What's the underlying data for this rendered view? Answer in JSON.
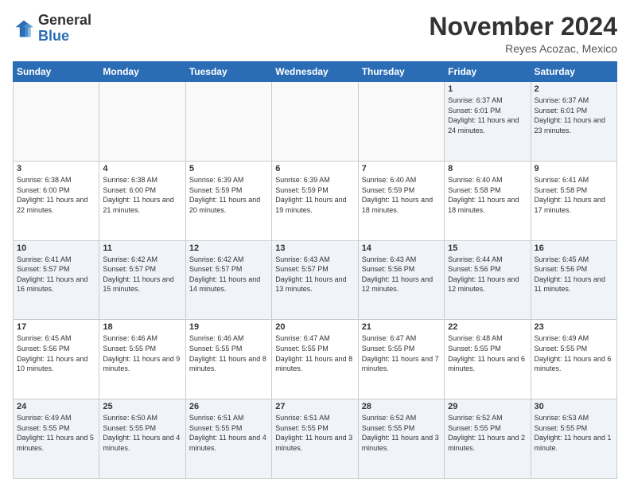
{
  "header": {
    "logo_general": "General",
    "logo_blue": "Blue",
    "month_title": "November 2024",
    "location": "Reyes Acozac, Mexico"
  },
  "weekdays": [
    "Sunday",
    "Monday",
    "Tuesday",
    "Wednesday",
    "Thursday",
    "Friday",
    "Saturday"
  ],
  "weeks": [
    [
      {
        "day": "",
        "info": ""
      },
      {
        "day": "",
        "info": ""
      },
      {
        "day": "",
        "info": ""
      },
      {
        "day": "",
        "info": ""
      },
      {
        "day": "",
        "info": ""
      },
      {
        "day": "1",
        "info": "Sunrise: 6:37 AM\nSunset: 6:01 PM\nDaylight: 11 hours and 24 minutes."
      },
      {
        "day": "2",
        "info": "Sunrise: 6:37 AM\nSunset: 6:01 PM\nDaylight: 11 hours and 23 minutes."
      }
    ],
    [
      {
        "day": "3",
        "info": "Sunrise: 6:38 AM\nSunset: 6:00 PM\nDaylight: 11 hours and 22 minutes."
      },
      {
        "day": "4",
        "info": "Sunrise: 6:38 AM\nSunset: 6:00 PM\nDaylight: 11 hours and 21 minutes."
      },
      {
        "day": "5",
        "info": "Sunrise: 6:39 AM\nSunset: 5:59 PM\nDaylight: 11 hours and 20 minutes."
      },
      {
        "day": "6",
        "info": "Sunrise: 6:39 AM\nSunset: 5:59 PM\nDaylight: 11 hours and 19 minutes."
      },
      {
        "day": "7",
        "info": "Sunrise: 6:40 AM\nSunset: 5:59 PM\nDaylight: 11 hours and 18 minutes."
      },
      {
        "day": "8",
        "info": "Sunrise: 6:40 AM\nSunset: 5:58 PM\nDaylight: 11 hours and 18 minutes."
      },
      {
        "day": "9",
        "info": "Sunrise: 6:41 AM\nSunset: 5:58 PM\nDaylight: 11 hours and 17 minutes."
      }
    ],
    [
      {
        "day": "10",
        "info": "Sunrise: 6:41 AM\nSunset: 5:57 PM\nDaylight: 11 hours and 16 minutes."
      },
      {
        "day": "11",
        "info": "Sunrise: 6:42 AM\nSunset: 5:57 PM\nDaylight: 11 hours and 15 minutes."
      },
      {
        "day": "12",
        "info": "Sunrise: 6:42 AM\nSunset: 5:57 PM\nDaylight: 11 hours and 14 minutes."
      },
      {
        "day": "13",
        "info": "Sunrise: 6:43 AM\nSunset: 5:57 PM\nDaylight: 11 hours and 13 minutes."
      },
      {
        "day": "14",
        "info": "Sunrise: 6:43 AM\nSunset: 5:56 PM\nDaylight: 11 hours and 12 minutes."
      },
      {
        "day": "15",
        "info": "Sunrise: 6:44 AM\nSunset: 5:56 PM\nDaylight: 11 hours and 12 minutes."
      },
      {
        "day": "16",
        "info": "Sunrise: 6:45 AM\nSunset: 5:56 PM\nDaylight: 11 hours and 11 minutes."
      }
    ],
    [
      {
        "day": "17",
        "info": "Sunrise: 6:45 AM\nSunset: 5:56 PM\nDaylight: 11 hours and 10 minutes."
      },
      {
        "day": "18",
        "info": "Sunrise: 6:46 AM\nSunset: 5:55 PM\nDaylight: 11 hours and 9 minutes."
      },
      {
        "day": "19",
        "info": "Sunrise: 6:46 AM\nSunset: 5:55 PM\nDaylight: 11 hours and 8 minutes."
      },
      {
        "day": "20",
        "info": "Sunrise: 6:47 AM\nSunset: 5:55 PM\nDaylight: 11 hours and 8 minutes."
      },
      {
        "day": "21",
        "info": "Sunrise: 6:47 AM\nSunset: 5:55 PM\nDaylight: 11 hours and 7 minutes."
      },
      {
        "day": "22",
        "info": "Sunrise: 6:48 AM\nSunset: 5:55 PM\nDaylight: 11 hours and 6 minutes."
      },
      {
        "day": "23",
        "info": "Sunrise: 6:49 AM\nSunset: 5:55 PM\nDaylight: 11 hours and 6 minutes."
      }
    ],
    [
      {
        "day": "24",
        "info": "Sunrise: 6:49 AM\nSunset: 5:55 PM\nDaylight: 11 hours and 5 minutes."
      },
      {
        "day": "25",
        "info": "Sunrise: 6:50 AM\nSunset: 5:55 PM\nDaylight: 11 hours and 4 minutes."
      },
      {
        "day": "26",
        "info": "Sunrise: 6:51 AM\nSunset: 5:55 PM\nDaylight: 11 hours and 4 minutes."
      },
      {
        "day": "27",
        "info": "Sunrise: 6:51 AM\nSunset: 5:55 PM\nDaylight: 11 hours and 3 minutes."
      },
      {
        "day": "28",
        "info": "Sunrise: 6:52 AM\nSunset: 5:55 PM\nDaylight: 11 hours and 3 minutes."
      },
      {
        "day": "29",
        "info": "Sunrise: 6:52 AM\nSunset: 5:55 PM\nDaylight: 11 hours and 2 minutes."
      },
      {
        "day": "30",
        "info": "Sunrise: 6:53 AM\nSunset: 5:55 PM\nDaylight: 11 hours and 1 minute."
      }
    ]
  ]
}
